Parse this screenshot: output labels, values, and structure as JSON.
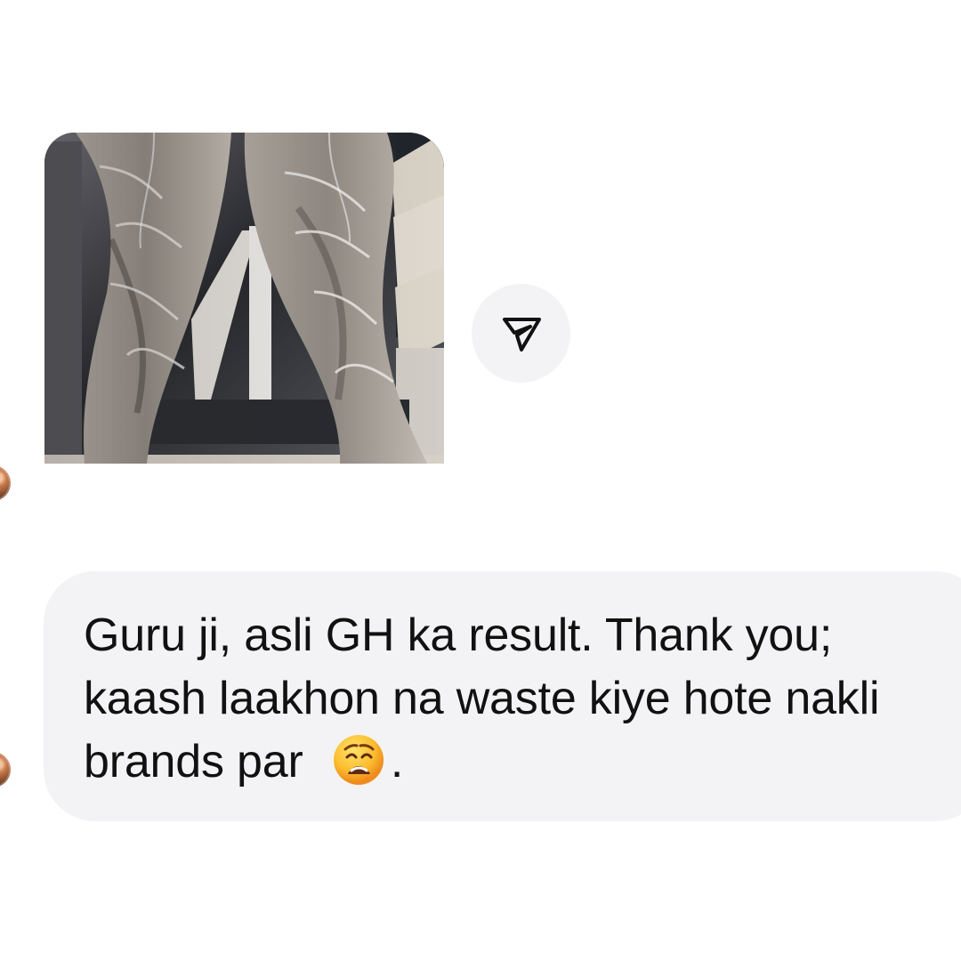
{
  "conversation": {
    "messages": [
      {
        "type": "photo",
        "image_description": "close-up of two muscular legs"
      },
      {
        "type": "text",
        "line1": "Guru ji, asli GH ka result. Thank you;",
        "line2": "kaash laakhon na waste kiye hote nakli",
        "line3": "brands par",
        "emoji": "weary-face-emoji",
        "end": "."
      }
    ],
    "share_icon": "send-icon"
  }
}
